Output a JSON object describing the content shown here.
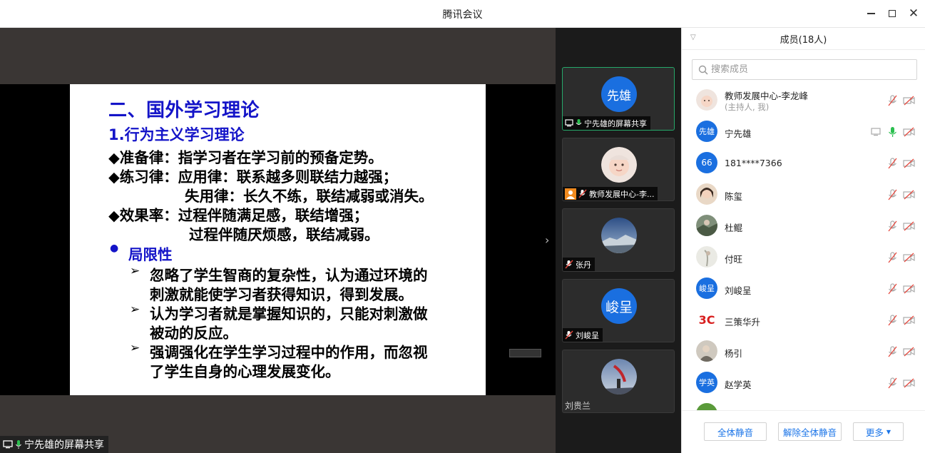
{
  "window": {
    "title": "腾讯会议"
  },
  "slide": {
    "title": "二、国外学习理论",
    "subtitle": "1.行为主义学习理论",
    "lines": [
      "◆准备律：指学习者在学习前的预备定势。",
      "◆练习律：应用律：联系越多则联结力越强；",
      "失用律：长久不练，联结减弱或消失。",
      "◆效果率：过程伴随满足感，联结增强；",
      "过程伴随厌烦感，联结减弱。"
    ],
    "section": "局限性",
    "points": [
      [
        "忽略了学生智商的复杂性，认为通过环境的",
        "刺激就能使学习者获得知识，得到发展。"
      ],
      [
        "认为学习者就是掌握知识的，只能对刺激做",
        "被动的反应。"
      ],
      [
        "强调强化在学生学习过程中的作用，而忽视",
        "了学生自身的心理发展变化。"
      ]
    ],
    "arrow": "➢",
    "bullet": "●"
  },
  "share_label": "宁先雄的屏幕共享",
  "tiles": [
    {
      "name": "宁先雄的屏幕共享",
      "avatar_text": "先雄",
      "avatar_color": "#1a6fe0",
      "active": true,
      "mic": "on",
      "share": true
    },
    {
      "name": "教师发展中心-李...",
      "avatar_text": "",
      "avatar_color": "#e8d6cf",
      "mic": "muted",
      "host": true
    },
    {
      "name": "张丹",
      "avatar_text": "",
      "avatar_color": "#5a7fa8",
      "mic": "muted"
    },
    {
      "name": "刘峻呈",
      "avatar_text": "峻呈",
      "avatar_color": "#1a6fe0",
      "mic": "muted"
    },
    {
      "name": "刘贵兰",
      "avatar_text": "",
      "avatar_color": "#6b7d96",
      "mic": "none"
    }
  ],
  "panel": {
    "header": "成员(18人)",
    "search_placeholder": "搜索成员",
    "members": [
      {
        "name": "教师发展中心-李龙峰",
        "sub": "(主持人, 我)",
        "avatar_text": "",
        "avatar_color": "#e8d6cf",
        "mic": "muted"
      },
      {
        "name": "宁先雄",
        "avatar_text": "先雄",
        "avatar_color": "#1a6fe0",
        "mic": "on",
        "screen": true
      },
      {
        "name": "181****7366",
        "avatar_text": "66",
        "avatar_color": "#1a6fe0",
        "mic": "muted"
      },
      {
        "name": "陈玺",
        "avatar_text": "",
        "avatar_color": "#d9b89a",
        "mic": "muted"
      },
      {
        "name": "杜鲲",
        "avatar_text": "",
        "avatar_color": "#5d6e58",
        "mic": "muted"
      },
      {
        "name": "付旺",
        "avatar_text": "",
        "avatar_color": "#d8d8d0",
        "mic": "muted"
      },
      {
        "name": "刘峻呈",
        "avatar_text": "峻呈",
        "avatar_color": "#1a6fe0",
        "mic": "muted"
      },
      {
        "name": "三策华升",
        "avatar_text": "3C",
        "avatar_color": "#ffffff",
        "mic": "muted",
        "logo": true
      },
      {
        "name": "杨引",
        "avatar_text": "",
        "avatar_color": "#8a857a",
        "mic": "muted"
      },
      {
        "name": "赵学英",
        "avatar_text": "学英",
        "avatar_color": "#1a6fe0",
        "mic": "muted"
      }
    ],
    "buttons": {
      "mute_all": "全体静音",
      "unmute_all": "解除全体静音",
      "more": "更多"
    }
  },
  "colors": {
    "accent": "#1a74e8",
    "mic_on": "#2bbf4f",
    "muted_red": "#e5483e"
  }
}
